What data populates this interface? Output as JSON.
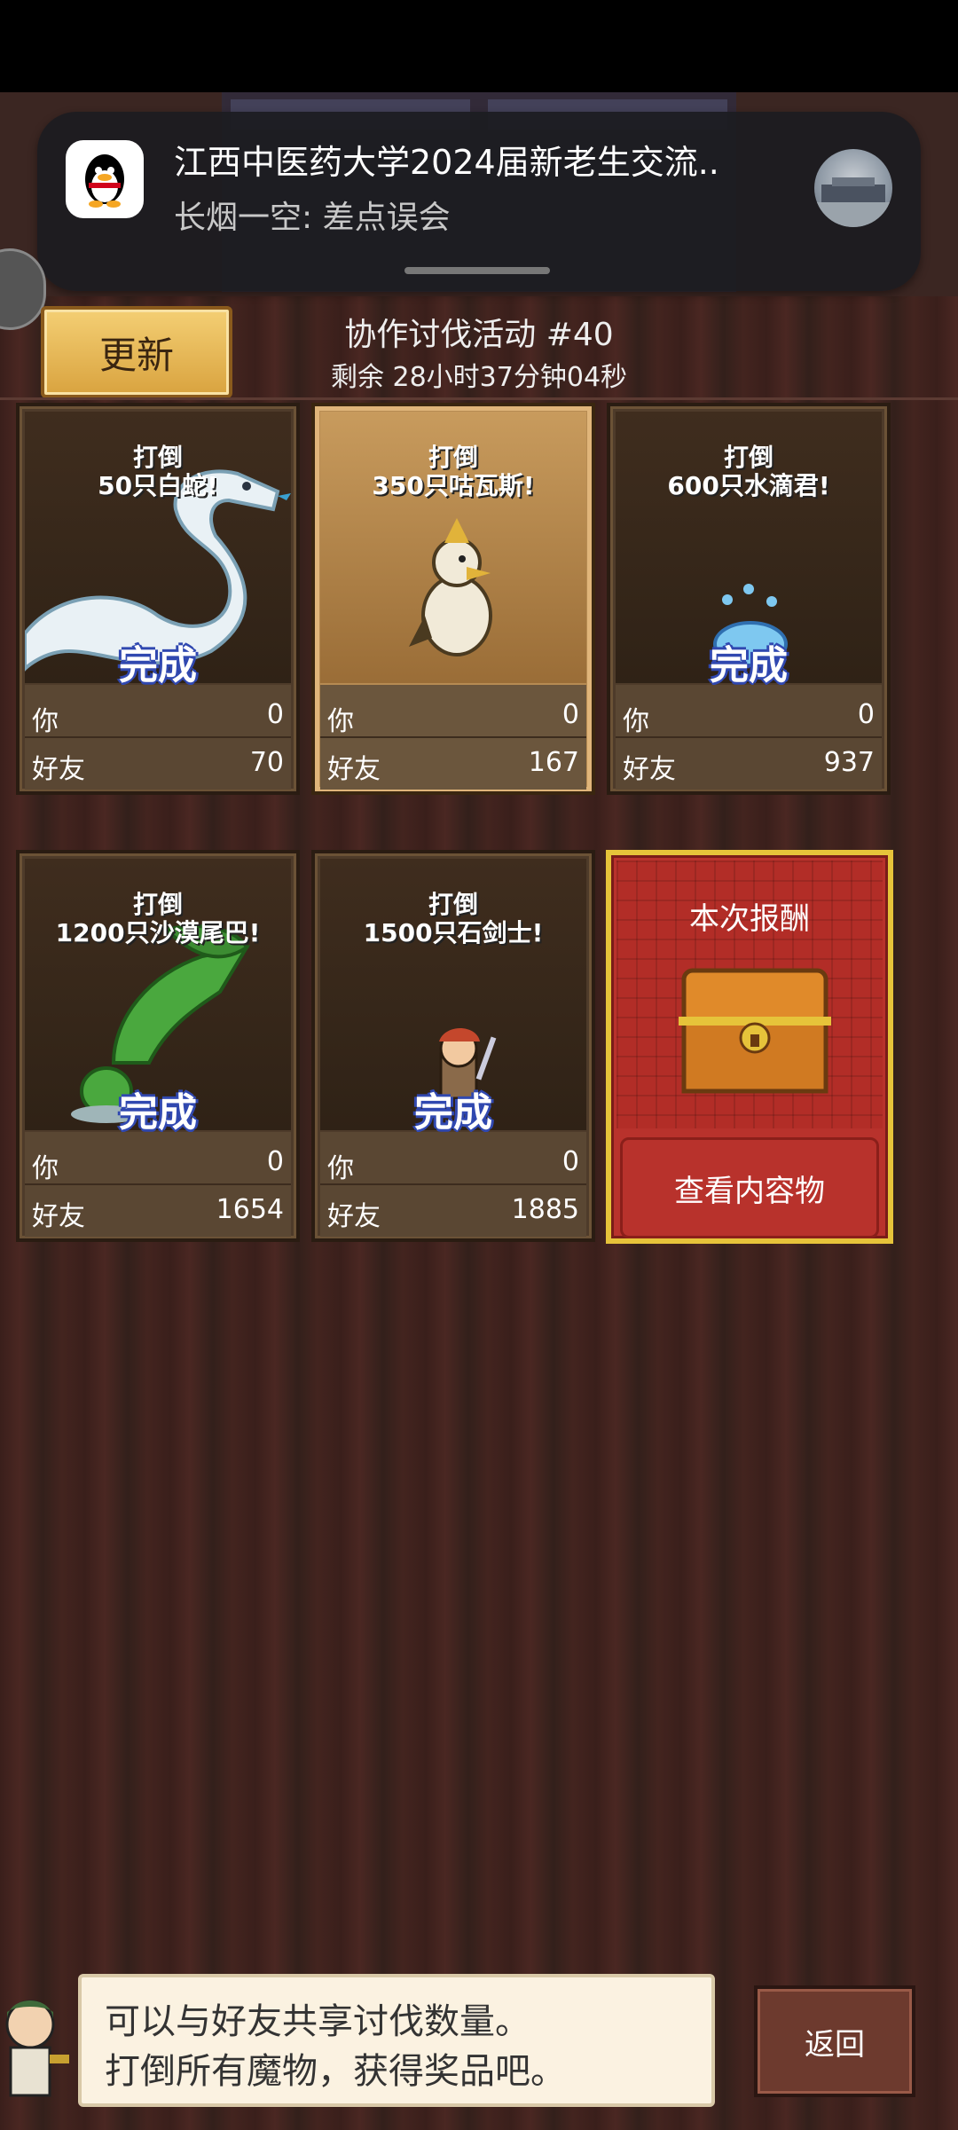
{
  "notification": {
    "title": "江西中医药大学2024届新老生交流..",
    "message": "长烟一空: 差点误会"
  },
  "header": {
    "update_label": "更新",
    "event_title": "协作讨伐活动 #40",
    "timer": "剩余 28小时37分钟04秒"
  },
  "cards": [
    {
      "line1": "打倒",
      "line2": "50只白蛇!",
      "done": "完成",
      "you_label": "你",
      "you_value": "0",
      "friend_label": "好友",
      "friend_value": "70"
    },
    {
      "line1": "打倒",
      "line2": "350只咕瓦斯!",
      "done": "",
      "you_label": "你",
      "you_value": "0",
      "friend_label": "好友",
      "friend_value": "167"
    },
    {
      "line1": "打倒",
      "line2": "600只水滴君!",
      "done": "完成",
      "you_label": "你",
      "you_value": "0",
      "friend_label": "好友",
      "friend_value": "937"
    },
    {
      "line1": "打倒",
      "line2": "1200只沙漠尾巴!",
      "done": "完成",
      "you_label": "你",
      "you_value": "0",
      "friend_label": "好友",
      "friend_value": "1654"
    },
    {
      "line1": "打倒",
      "line2": "1500只石剑士!",
      "done": "完成",
      "you_label": "你",
      "you_value": "0",
      "friend_label": "好友",
      "friend_value": "1885"
    }
  ],
  "reward": {
    "title": "本次报酬",
    "button": "查看内容物"
  },
  "bottom": {
    "message_line1": "可以与好友共享讨伐数量。",
    "message_line2": "打倒所有魔物，获得奖品吧。",
    "back_label": "返回"
  }
}
